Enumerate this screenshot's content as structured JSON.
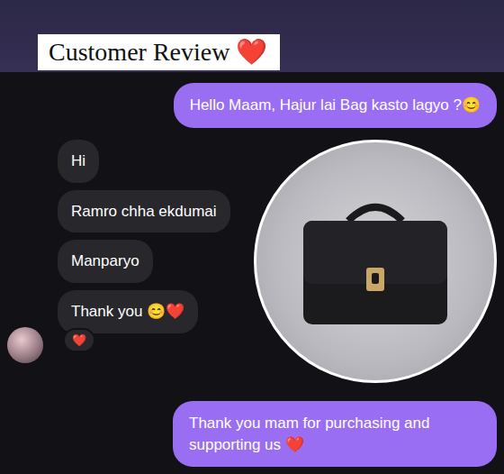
{
  "header": {
    "title": "Customer Review ❤️"
  },
  "messages": [
    {
      "kind": "outgoing",
      "text": "Hello Maam, Hajur lai Bag kasto lagyo ?😊"
    },
    {
      "kind": "incoming-group",
      "bubbles": [
        "Hi",
        "Ramro chha ekdumai",
        "Manparyo",
        "Thank you 😊❤️"
      ],
      "reaction": "❤️"
    },
    {
      "kind": "outgoing",
      "text": "Thank you mam for purchasing and supporting us ❤️"
    }
  ]
}
